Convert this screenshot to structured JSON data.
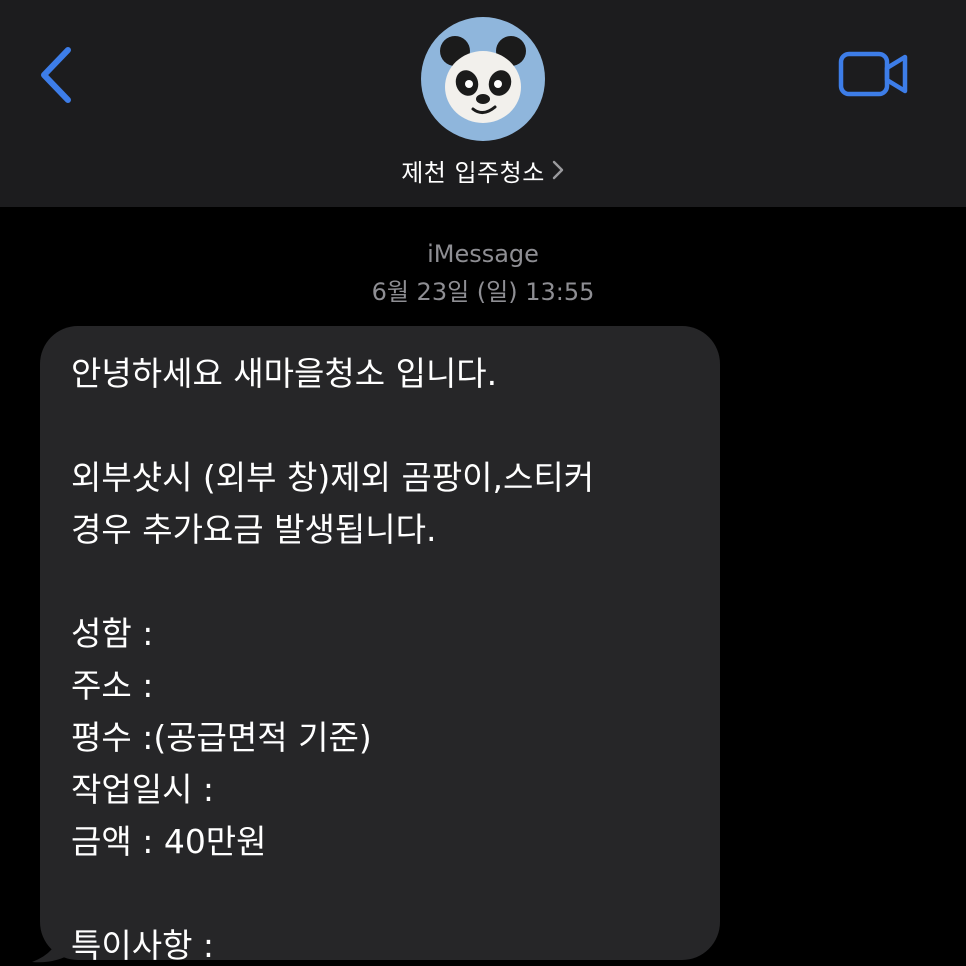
{
  "header": {
    "contact_name": "제천 입주청소",
    "avatar_icon": "panda-memoji-icon",
    "back_icon": "chevron-left-icon",
    "facetime_icon": "video-camera-icon",
    "accent_color": "#3b82f6"
  },
  "transcript": {
    "service": "iMessage",
    "timestamp": "6월 23일 (일) 13:55"
  },
  "message": {
    "lines": [
      "안녕하세요 새마을청소 입니다.",
      "",
      "외부샷시 (외부 창)제외 곰팡이,스티커",
      "경우 추가요금 발생됩니다.",
      "",
      "성함 :",
      "주소 :",
      "평수 :(공급면적 기준)",
      "작업일시 :",
      "금액 : 40만원",
      "",
      "특이사항 :"
    ]
  }
}
